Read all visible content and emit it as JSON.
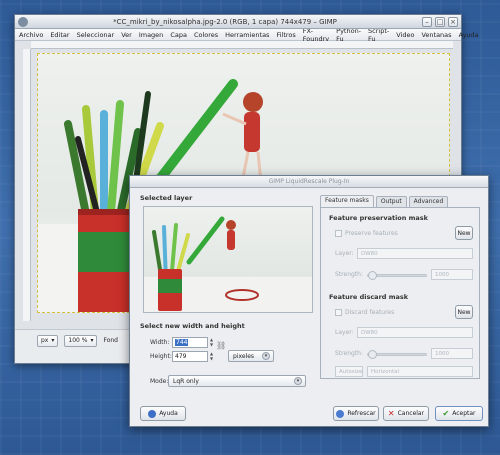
{
  "main_window": {
    "title": "*CC_mikri_by_nikosalpha.jpg-2.0 (RGB, 1 capa) 744x479 – GIMP",
    "menu": [
      "Archivo",
      "Editar",
      "Seleccionar",
      "Ver",
      "Imagen",
      "Capa",
      "Colores",
      "Herramientas",
      "Filtros",
      "FX-Foundry",
      "Python-Fu",
      "Script-Fu",
      "Video",
      "Ventanas",
      "Ayuda"
    ],
    "status": {
      "unit": "px",
      "zoom": "100 %",
      "fondo_label": "Fond"
    }
  },
  "dialog": {
    "title": "GIMP LiquidRescale Plug-In",
    "selected_layer_label": "Selected layer",
    "new_size_label": "Select new width and height",
    "width_label": "Width:",
    "width_value": "744",
    "height_label": "Height:",
    "height_value": "479",
    "unit_value": "pixeles",
    "mode_label": "Mode:",
    "mode_value": "LqR only",
    "tabs": [
      "Feature masks",
      "Output",
      "Advanced"
    ],
    "preservation": {
      "heading": "Feature preservation mask",
      "checkbox_label": "Preserve features",
      "new_button": "New",
      "layer_label": "Layer:",
      "layer_value": "DW80",
      "strength_label": "Strength:",
      "strength_value": "1000"
    },
    "discard": {
      "heading": "Feature discard mask",
      "checkbox_label": "Discard features",
      "new_button": "New",
      "layer_label": "Layer:",
      "layer_value": "DW80",
      "strength_label": "Strength:",
      "strength_value": "1000",
      "autosize_label": "Autosize",
      "orientation_value": "Horizontal"
    },
    "buttons": {
      "help": "Ayuda",
      "refresh": "Refrescar",
      "cancel": "Cancelar",
      "accept": "Aceptar"
    }
  }
}
